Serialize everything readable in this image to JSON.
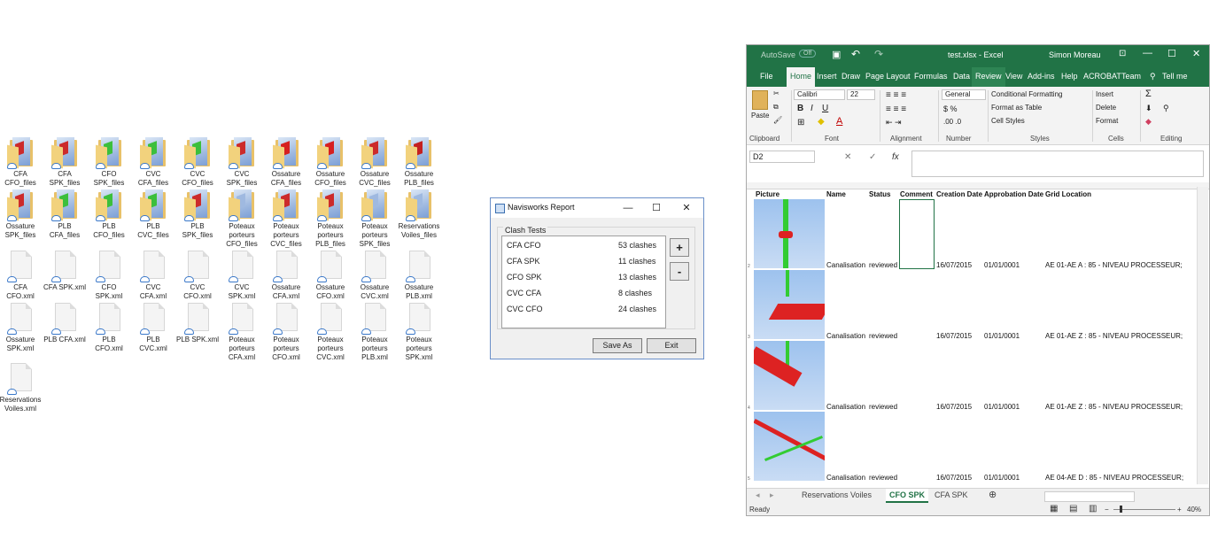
{
  "desktop": {
    "icons": [
      {
        "label": "CFA CFO_files",
        "kind": "folder",
        "accent": "#cc2b2b"
      },
      {
        "label": "CFA SPK_files",
        "kind": "folder",
        "accent": "#cc2b2b"
      },
      {
        "label": "CFO SPK_files",
        "kind": "folder",
        "accent": "#3cbf3c"
      },
      {
        "label": "CVC CFA_files",
        "kind": "folder",
        "accent": "#3cbf3c"
      },
      {
        "label": "CVC CFO_files",
        "kind": "folder",
        "accent": "#3cbf3c"
      },
      {
        "label": "CVC SPK_files",
        "kind": "folder",
        "accent": "#cc2b2b"
      },
      {
        "label": "Ossature CFA_files",
        "kind": "folder",
        "accent": "#d62020"
      },
      {
        "label": "Ossature CFO_files",
        "kind": "folder",
        "accent": "#d62020"
      },
      {
        "label": "Ossature CVC_files",
        "kind": "folder",
        "accent": "#cc2b2b"
      },
      {
        "label": "Ossature PLB_files",
        "kind": "folder",
        "accent": "#c42020"
      },
      {
        "label": "Ossature SPK_files",
        "kind": "folder",
        "accent": "#cc2b2b"
      },
      {
        "label": "PLB CFA_files",
        "kind": "folder",
        "accent": "#3cbf3c"
      },
      {
        "label": "PLB CFO_files",
        "kind": "folder",
        "accent": "#3cbf3c"
      },
      {
        "label": "PLB CVC_files",
        "kind": "folder",
        "accent": "#3cbf3c"
      },
      {
        "label": "PLB SPK_files",
        "kind": "folder",
        "accent": "#cc2b2b"
      },
      {
        "label": "Poteaux porteurs CFO_files",
        "kind": "folder",
        "accent": "#9fb9e0"
      },
      {
        "label": "Poteaux porteurs CVC_files",
        "kind": "folder",
        "accent": "#cc2b2b"
      },
      {
        "label": "Poteaux porteurs PLB_files",
        "kind": "folder",
        "accent": "#cc2b2b"
      },
      {
        "label": "Poteaux porteurs SPK_files",
        "kind": "folder",
        "accent": "#9fb9e0"
      },
      {
        "label": "Reservations Voiles_files",
        "kind": "folder",
        "accent": "#9fb9e0"
      },
      {
        "label": "CFA CFO.xml",
        "kind": "file"
      },
      {
        "label": "CFA SPK.xml",
        "kind": "file"
      },
      {
        "label": "CFO SPK.xml",
        "kind": "file"
      },
      {
        "label": "CVC CFA.xml",
        "kind": "file"
      },
      {
        "label": "CVC CFO.xml",
        "kind": "file"
      },
      {
        "label": "CVC SPK.xml",
        "kind": "file"
      },
      {
        "label": "Ossature CFA.xml",
        "kind": "file"
      },
      {
        "label": "Ossature CFO.xml",
        "kind": "file"
      },
      {
        "label": "Ossature CVC.xml",
        "kind": "file"
      },
      {
        "label": "Ossature PLB.xml",
        "kind": "file"
      },
      {
        "label": "Ossature SPK.xml",
        "kind": "file"
      },
      {
        "label": "PLB CFA.xml",
        "kind": "file"
      },
      {
        "label": "PLB CFO.xml",
        "kind": "file"
      },
      {
        "label": "PLB CVC.xml",
        "kind": "file"
      },
      {
        "label": "PLB SPK.xml",
        "kind": "file"
      },
      {
        "label": "Poteaux porteurs CFA.xml",
        "kind": "file"
      },
      {
        "label": "Poteaux porteurs CFO.xml",
        "kind": "file"
      },
      {
        "label": "Poteaux porteurs CVC.xml",
        "kind": "file"
      },
      {
        "label": "Poteaux porteurs PLB.xml",
        "kind": "file"
      },
      {
        "label": "Poteaux porteurs SPK.xml",
        "kind": "file"
      },
      {
        "label": "Reservations Voiles.xml",
        "kind": "file"
      }
    ]
  },
  "navis": {
    "title": "Navisworks Report",
    "minimize": "—",
    "maximize": "☐",
    "close": "✕",
    "group_label": "Clash Tests",
    "tests": [
      {
        "name": "CFA CFO",
        "count": "53 clashes"
      },
      {
        "name": "CFA SPK",
        "count": "11 clashes"
      },
      {
        "name": "CFO SPK",
        "count": "13 clashes"
      },
      {
        "name": "CVC CFA",
        "count": "8 clashes"
      },
      {
        "name": "CVC CFO",
        "count": "24 clashes"
      }
    ],
    "plus": "+",
    "minus": "-",
    "save_as": "Save As",
    "exit": "Exit"
  },
  "excel": {
    "autosave": "AutoSave",
    "autosave_state": "Off",
    "file_name": "test.xlsx  -  Excel",
    "user": "Simon Moreau",
    "tabs": [
      "File",
      "Home",
      "Insert",
      "Draw",
      "Page Layout",
      "Formulas",
      "Data",
      "Review",
      "View",
      "Add-ins",
      "Help",
      "ACROBAT",
      "Team",
      "Tell me"
    ],
    "ribbon": {
      "paste": "Paste",
      "clipboard": "Clipboard",
      "font_name": "Calibri",
      "font_size": "22",
      "font": "Font",
      "alignment": "Alignment",
      "number_format": "General",
      "number": "Number",
      "cond_format": "Conditional Formatting",
      "format_table": "Format as Table",
      "cell_styles": "Cell Styles",
      "styles": "Styles",
      "insert": "Insert",
      "delete": "Delete",
      "format": "Format",
      "cells": "Cells",
      "editing": "Editing"
    },
    "name_box": "D2",
    "fx": "fx",
    "headers": [
      "Picture",
      "Name",
      "Status",
      "Comment",
      "Creation Date",
      "Approbation Date",
      "Grid Location"
    ],
    "rows": [
      {
        "num": "2",
        "name": "Canalisation",
        "status": "reviewed",
        "created": "16/07/2015",
        "approved": "01/01/0001",
        "grid": "AE 01-AE A : 85 - NIVEAU PROCESSEUR;"
      },
      {
        "num": "3",
        "name": "Canalisation",
        "status": "reviewed",
        "created": "16/07/2015",
        "approved": "01/01/0001",
        "grid": "AE 01-AE Z : 85 - NIVEAU PROCESSEUR;"
      },
      {
        "num": "4",
        "name": "Canalisation",
        "status": "reviewed",
        "created": "16/07/2015",
        "approved": "01/01/0001",
        "grid": "AE 01-AE Z : 85 - NIVEAU PROCESSEUR;"
      },
      {
        "num": "5",
        "name": "Canalisation",
        "status": "reviewed",
        "created": "16/07/2015",
        "approved": "01/01/0001",
        "grid": "AE 04-AE D : 85 - NIVEAU PROCESSEUR;"
      }
    ],
    "sheets": [
      "Reservations Voiles",
      "CFO SPK",
      "CFA SPK"
    ],
    "active_sheet": "CFO SPK",
    "status": "Ready",
    "zoom": "40%",
    "accent": "#217346"
  }
}
